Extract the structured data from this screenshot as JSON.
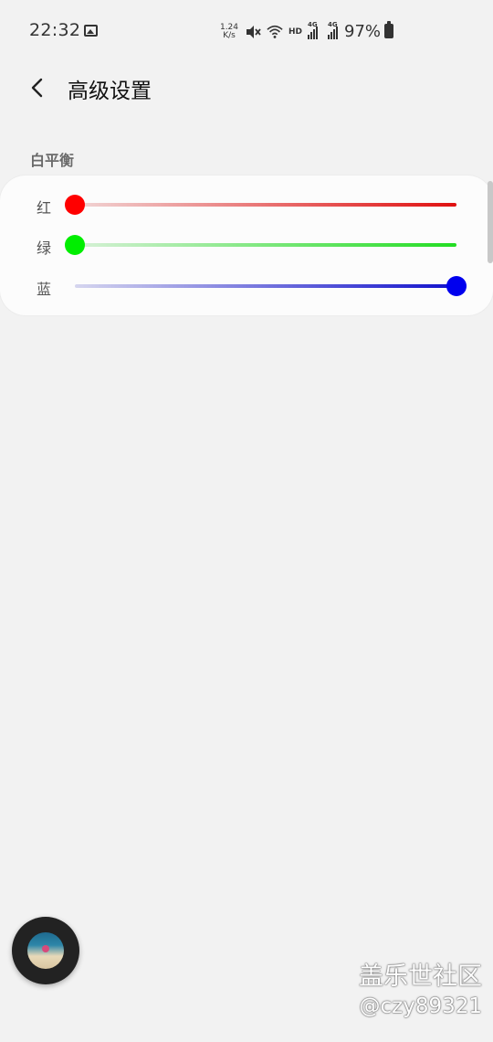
{
  "status_bar": {
    "time": "22:32",
    "net_speed_value": "1.24",
    "net_speed_unit": "K/s",
    "hd_label": "HD",
    "sim1_label": "4G",
    "sim2_label": "4G",
    "battery_percent": "97%",
    "icons": [
      "gallery-icon",
      "mute-icon",
      "wifi-icon",
      "signal-icon",
      "battery-icon"
    ]
  },
  "header": {
    "back_icon": "back-arrow-icon",
    "title": "高级设置"
  },
  "white_balance": {
    "section_title": "白平衡",
    "sliders": [
      {
        "label": "红",
        "color": "#e01010",
        "thumb_color": "#ff0000",
        "value": 0.0
      },
      {
        "label": "绿",
        "color": "#22dd22",
        "thumb_color": "#00ee00",
        "value": 0.0
      },
      {
        "label": "蓝",
        "color": "#1010cc",
        "thumb_color": "#0000ee",
        "value": 1.0
      }
    ]
  },
  "floating_button": {
    "icon": "floating-media-icon"
  },
  "watermark": {
    "title": "盖乐世社区",
    "user": "@czy89321"
  }
}
